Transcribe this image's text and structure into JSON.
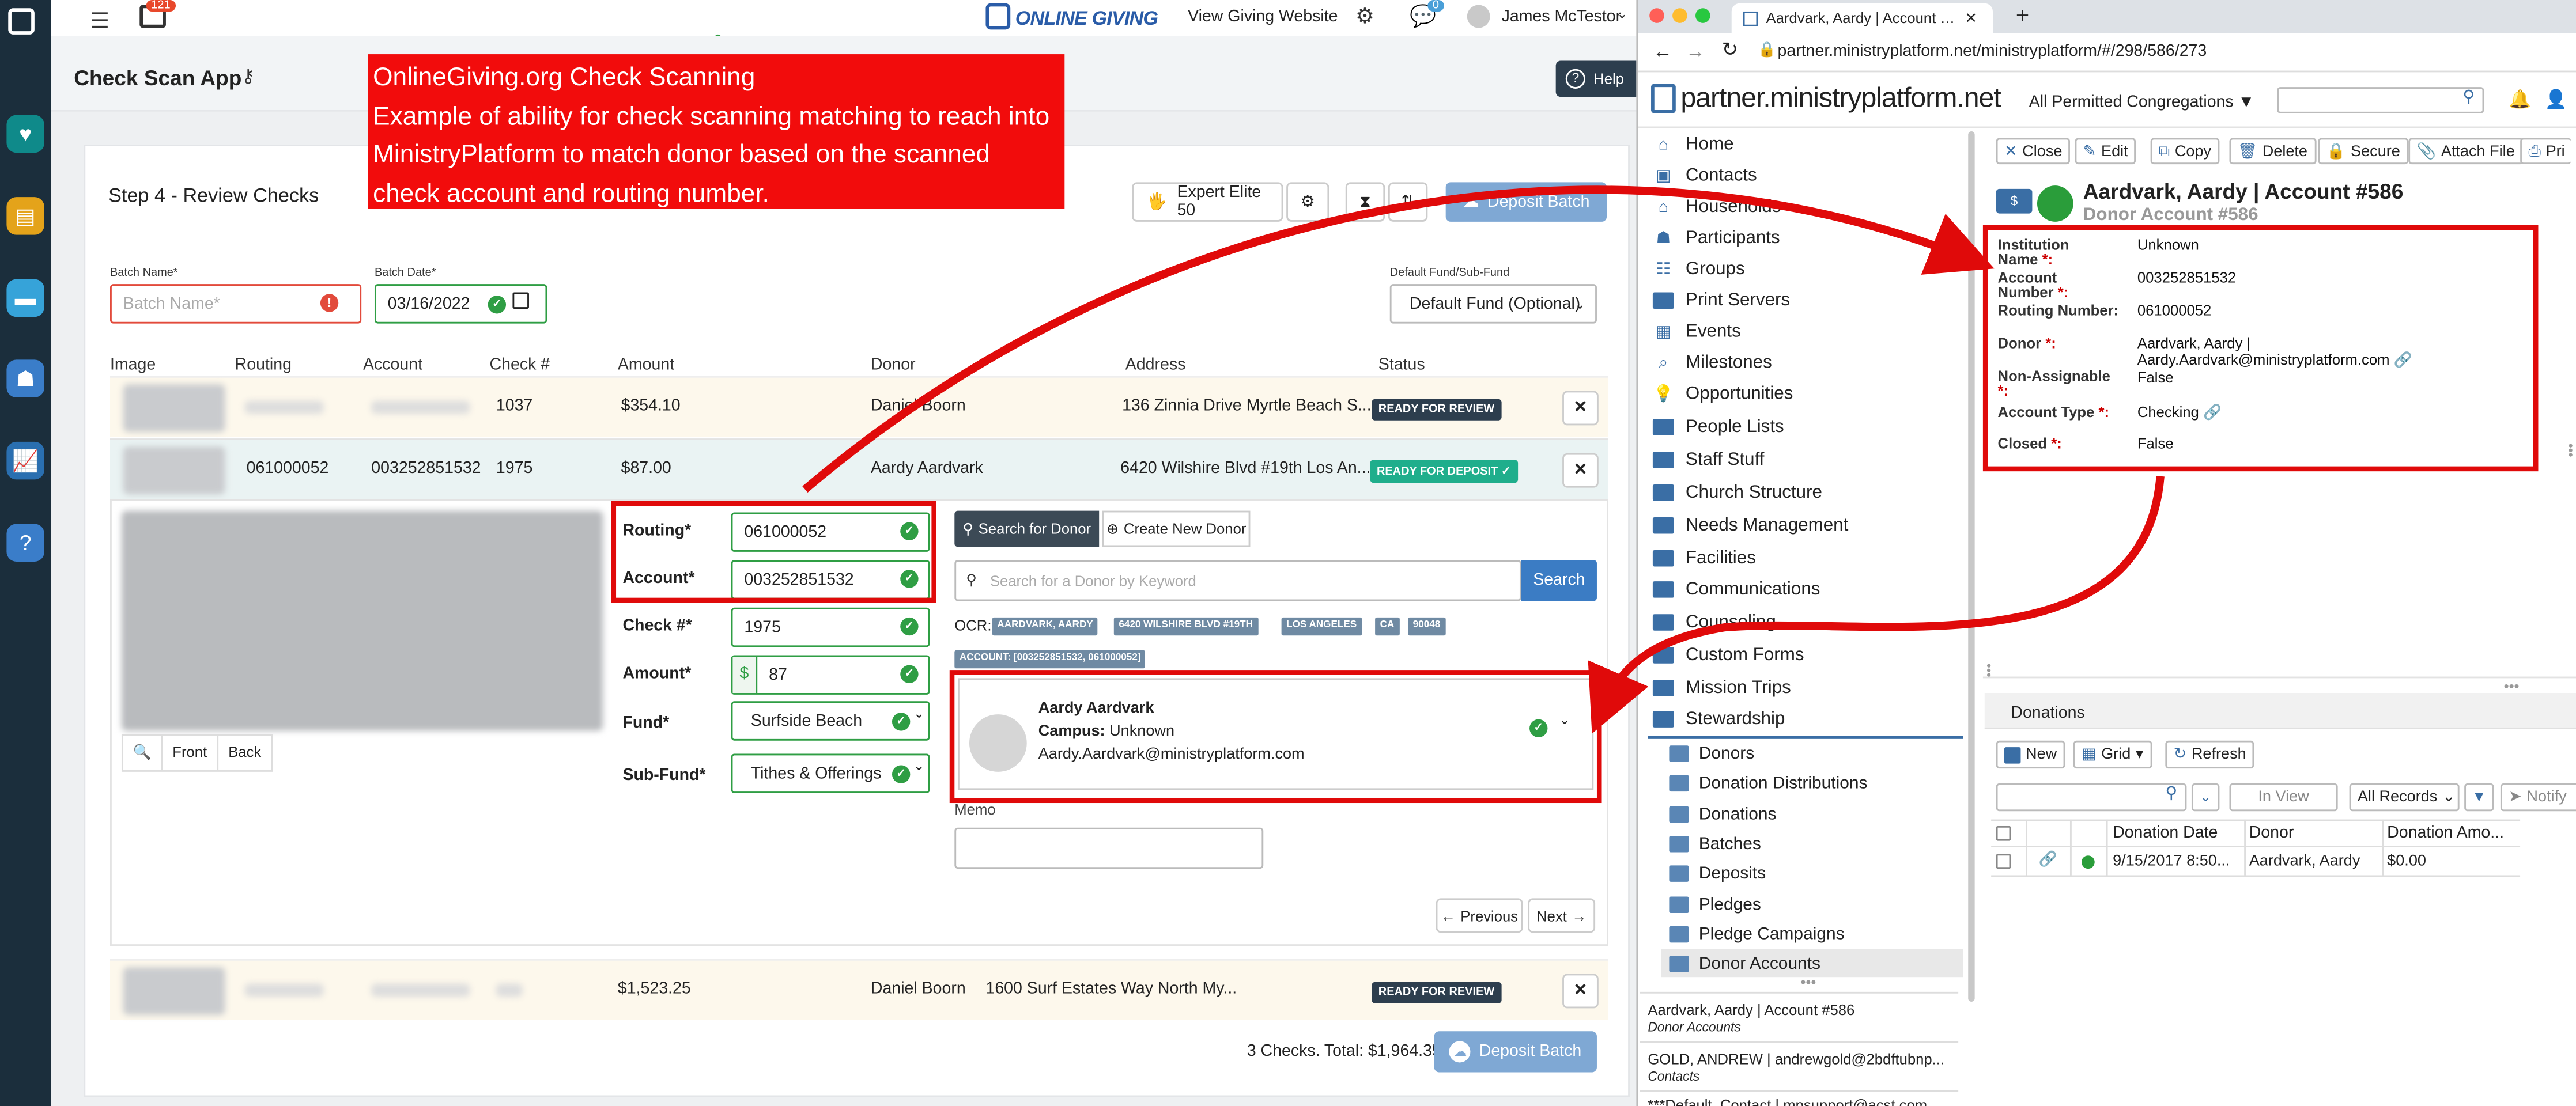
{
  "og": {
    "notif_count": "121",
    "brand": "ONLINE GIVING",
    "view_site": "View Giving Website",
    "chat_count": "0",
    "user": "James McTestor",
    "app_title": "Check Scan App",
    "help": "Help",
    "step_title": "Step 4 - Review Checks",
    "scanner": "Expert Elite 50",
    "deposit_batch": "Deposit Batch",
    "batch_name_label": "Batch Name*",
    "batch_name_placeholder": "Batch Name*",
    "batch_date_label": "Batch Date*",
    "batch_date": "03/16/2022",
    "fund_label": "Default Fund/Sub-Fund",
    "fund_value": "Default Fund (Optional)",
    "columns": [
      "Image",
      "Routing",
      "Account",
      "Check #",
      "Amount",
      "Donor",
      "Address",
      "Status"
    ],
    "rows": [
      {
        "check": "1037",
        "amount": "$354.10",
        "donor": "Daniel Boorn",
        "address": "136 Zinnia Drive Myrtle Beach S...",
        "status": "READY FOR REVIEW"
      },
      {
        "routing": "061000052",
        "account": "003252851532",
        "check": "1975",
        "amount": "$87.00",
        "donor": "Aardy Aardvark",
        "address": "6420 Wilshire Blvd #19th Los An...",
        "status": "READY FOR DEPOSIT"
      },
      {
        "amount": "$1,523.25",
        "donor": "Daniel Boorn",
        "address": "1600 Surf Estates Way North My...",
        "status": "READY FOR REVIEW"
      }
    ],
    "detail": {
      "front": "Front",
      "back": "Back",
      "routing_label": "Routing*",
      "routing": "061000052",
      "account_label": "Account*",
      "account": "003252851532",
      "check_label": "Check #*",
      "check": "1975",
      "amount_label": "Amount*",
      "currency": "$",
      "amount": "87",
      "fund_label": "Fund*",
      "fund": "Surfside Beach",
      "subfund_label": "Sub-Fund*",
      "subfund": "Tithes & Offerings",
      "search_donor": "Search for Donor",
      "create_donor": "Create New Donor",
      "search_placeholder": "Search for a Donor by Keyword",
      "search_btn": "Search",
      "ocr_label": "OCR:",
      "ocr_tags": [
        "AARDVARK, AARDY",
        "6420 WILSHIRE BLVD #19TH",
        "LOS ANGELES",
        "CA",
        "90048"
      ],
      "ocr_account": "ACCOUNT: [003252851532, 061000052]",
      "donor_name": "Aardy Aardvark",
      "donor_campus_label": "Campus:",
      "donor_campus": "Unknown",
      "donor_email": "Aardy.Aardvark@ministryplatform.com",
      "memo": "Memo",
      "previous": "Previous",
      "next": "Next"
    },
    "footer_total": "3 Checks. Total: $1,964.35",
    "annotation_title": "OnlineGiving.org Check Scanning",
    "annotation_body": "Example of ability for check scanning matching to reach into MinistryPlatform to match donor based on the scanned check account and routing number."
  },
  "browser": {
    "tab_title": "Aardvark, Aardy | Account #586",
    "url": "partner.ministryplatform.net/ministryplatform/#/298/586/273",
    "brand": "partner.ministryplatform.net",
    "congregations": "All Permitted Congregations",
    "nav": [
      "Home",
      "Contacts",
      "Households",
      "Participants",
      "Groups",
      "Print Servers",
      "Events",
      "Milestones",
      "Opportunities",
      "People Lists",
      "Staff Stuff",
      "Church Structure",
      "Needs Management",
      "Facilities",
      "Communications",
      "Counseling",
      "Custom Forms",
      "Mission Trips",
      "Stewardship"
    ],
    "sub_nav": [
      "Donors",
      "Donation Distributions",
      "Donations",
      "Batches",
      "Deposits",
      "Pledges",
      "Pledge Campaigns",
      "Donor Accounts"
    ],
    "recent": [
      {
        "title": "Aardvark, Aardy | Account #586",
        "type": "Donor Accounts"
      },
      {
        "title": "GOLD, ANDREW | andrewgold@2bdftubnp...",
        "type": "Contacts"
      },
      {
        "title": "***Default_Contact | mpsupport@acst.com",
        "type": ""
      }
    ],
    "toolbar": [
      "Close",
      "Edit",
      "Copy",
      "Delete",
      "Secure",
      "Attach File",
      "Pri"
    ],
    "record_title": "Aardvark, Aardy | Account #586",
    "record_subtitle": "Donor Account #586",
    "fields": {
      "institution_label": "Institution Name",
      "institution": "Unknown",
      "account_label": "Account Number",
      "account": "003252851532",
      "routing_label": "Routing Number:",
      "routing": "061000052",
      "donor_label": "Donor",
      "donor_line1": "Aardvark, Aardy |",
      "donor_line2": "Aardy.Aardvark@ministryplatform.com",
      "nonassign_label": "Non-Assignable",
      "nonassign": "False",
      "type_label": "Account Type",
      "type": "Checking",
      "closed_label": "Closed",
      "closed": "False"
    },
    "donations": {
      "tab": "Donations",
      "new": "New",
      "grid": "Grid",
      "refresh": "Refresh",
      "in_view": "In View",
      "all_records": "All Records",
      "notify": "Notify",
      "columns": [
        "Donation Date",
        "Donor",
        "Donation Amo..."
      ],
      "row": {
        "date": "9/15/2017 8:50...",
        "donor": "Aardvark, Aardy",
        "amount": "$0.00"
      }
    }
  }
}
